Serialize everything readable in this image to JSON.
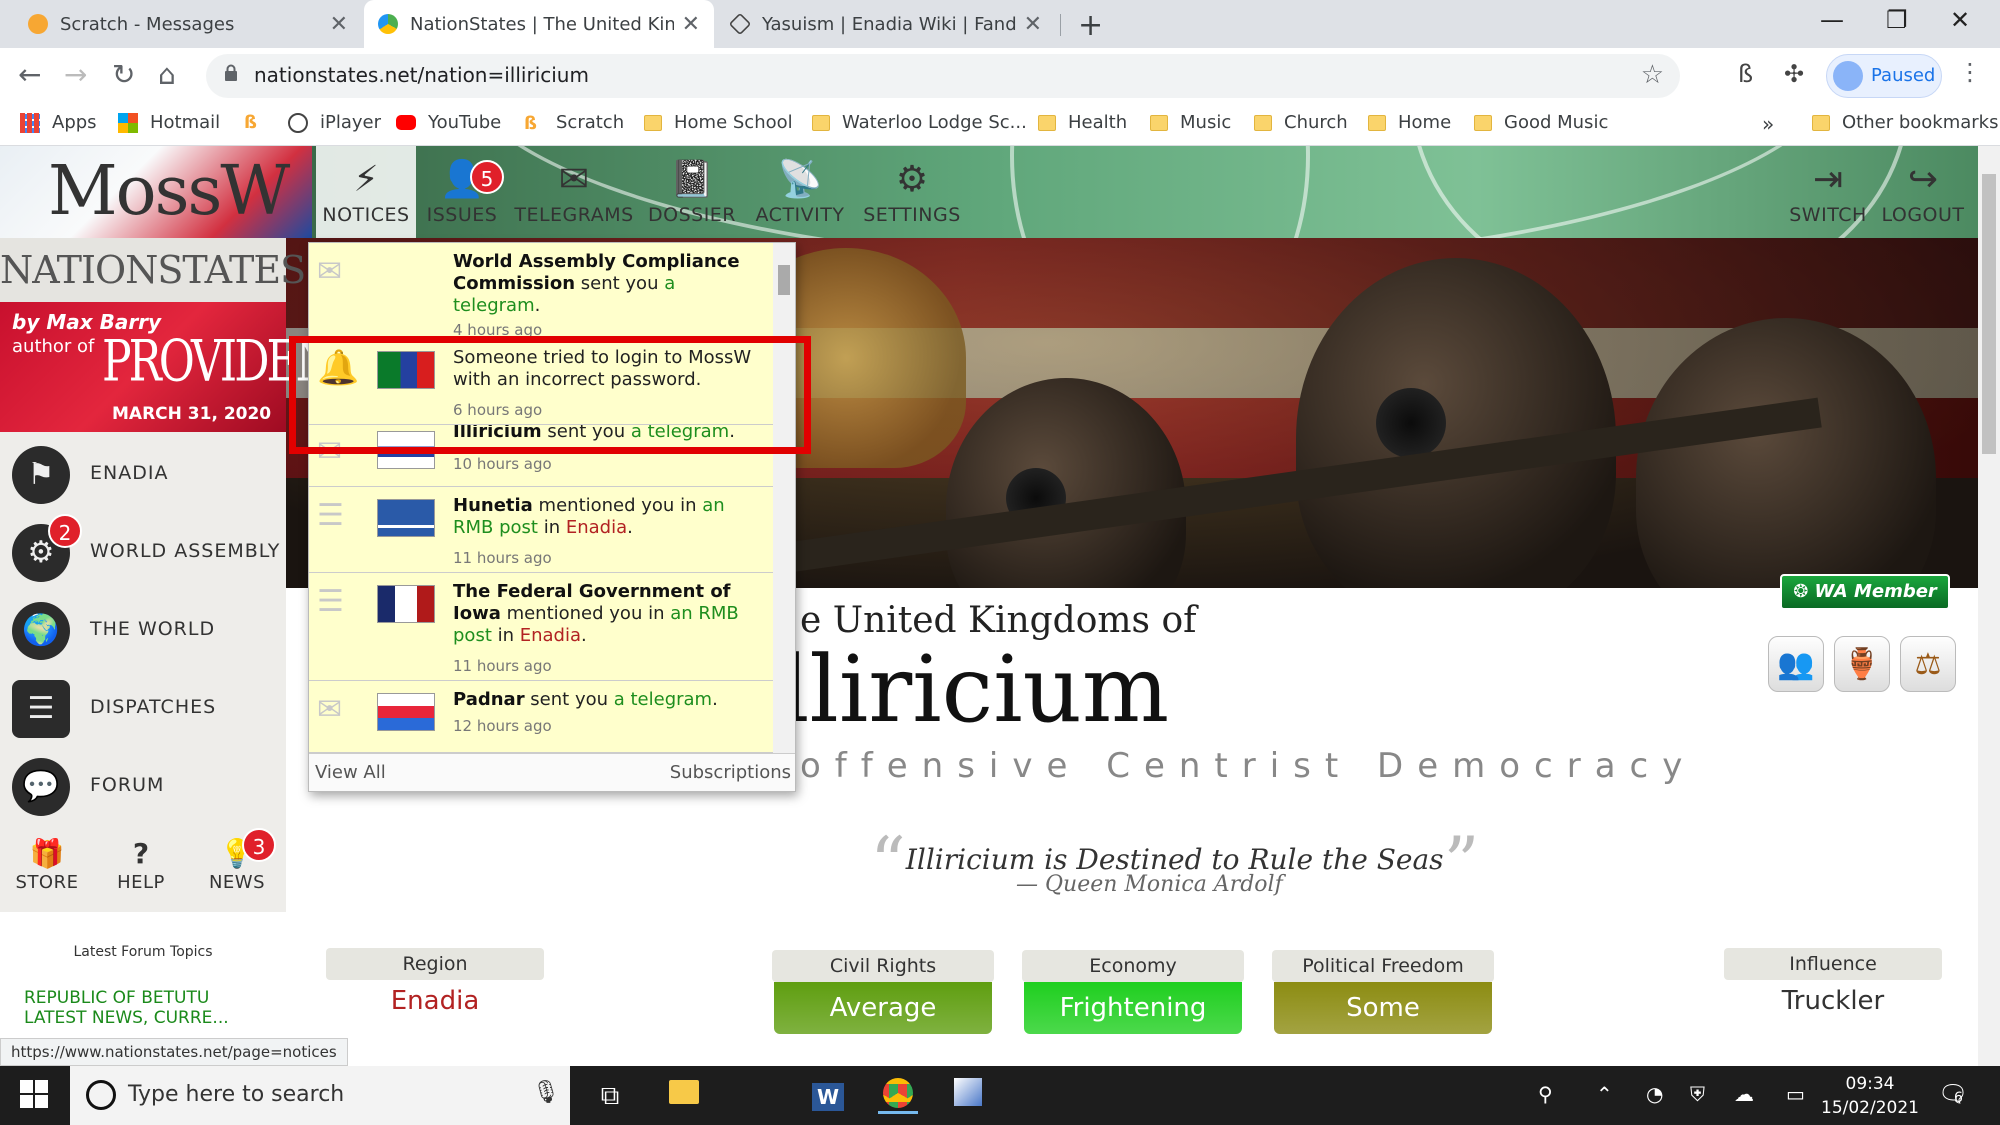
{
  "browser": {
    "tabs": [
      {
        "title": "Scratch - Messages"
      },
      {
        "title": "NationStates | The United Kingdo"
      },
      {
        "title": "Yasuism | Enadia Wiki | Fandom"
      }
    ],
    "url": "nationstates.net/nation=illiricium",
    "profile_label": "Paused",
    "bookmarks": [
      "Apps",
      "Hotmail",
      "iPlayer",
      "YouTube",
      "Scratch",
      "Home School",
      "Waterloo Lodge Sc...",
      "Health",
      "Music",
      "Church",
      "Home",
      "Good Music"
    ],
    "more_label": "»",
    "other_bookmarks": "Other bookmarks",
    "status_url": "https://www.nationstates.net/page=notices"
  },
  "site": {
    "logo": "MossW",
    "brand": "NATIONSTATES",
    "topnav": [
      {
        "label": "NOTICES",
        "icon": "⚡"
      },
      {
        "label": "ISSUES",
        "icon": "👤",
        "badge": "5"
      },
      {
        "label": "TELEGRAMS",
        "icon": "✉"
      },
      {
        "label": "DOSSIER",
        "icon": "📓"
      },
      {
        "label": "ACTIVITY",
        "icon": "📡"
      },
      {
        "label": "SETTINGS",
        "icon": "⚙"
      }
    ],
    "topnav_right": [
      {
        "label": "SWITCH",
        "icon": "⇥"
      },
      {
        "label": "LOGOUT",
        "icon": "↪"
      }
    ],
    "ad": {
      "by": "by Max Barry",
      "author_of": "author of",
      "book": "PROVIDENCE",
      "date": "MARCH 31, 2020"
    },
    "sidenav": [
      {
        "label": "ENADIA",
        "icon": "⚑"
      },
      {
        "label": "WORLD ASSEMBLY",
        "icon": "⚙",
        "badge": "2"
      },
      {
        "label": "THE WORLD",
        "icon": "🌍"
      },
      {
        "label": "DISPATCHES",
        "icon": "☰"
      },
      {
        "label": "FORUM",
        "icon": "💬"
      }
    ],
    "sidebottom": [
      {
        "label": "STORE",
        "icon": "🎁"
      },
      {
        "label": "HELP",
        "icon": "?"
      },
      {
        "label": "NEWS",
        "icon": "💡",
        "badge": "3"
      }
    ],
    "latest_forum_title": "Latest Forum Topics",
    "latest_forum_item_line1": "REPUBLIC OF BETUTU",
    "latest_forum_item_line2": "LATEST NEWS, CURRE..."
  },
  "nation": {
    "pretitle": "e United Kingdoms of",
    "name": "lliricium",
    "type": "offensive Centrist Democracy",
    "motto": "Illiricium is Destined to Rule the Seas",
    "motto_by": "— Queen Monica Ardolf",
    "wa_badge": "WA Member",
    "stats": [
      {
        "head": "Region",
        "value": "Enadia"
      },
      {
        "head": "Civil Rights",
        "value": "Average",
        "color": "#5f9e10"
      },
      {
        "head": "Economy",
        "value": "Frightening",
        "color": "#1fcf1f"
      },
      {
        "head": "Political Freedom",
        "value": "Some",
        "color": "#8c8c12"
      },
      {
        "head": "Influence",
        "value": "Truckler"
      }
    ]
  },
  "notices": {
    "items": [
      {
        "title": "World Assembly Compliance Commission",
        "mid": " sent you ",
        "link": "a telegram",
        "end": ".",
        "time": "4 hours ago",
        "icon": "envelope-icon"
      },
      {
        "text": "Someone tried to login to MossW with an incorrect password.",
        "time": "6 hours ago",
        "icon": "bell-icon"
      },
      {
        "title": "Illiricium",
        "mid": " sent you ",
        "link": "a telegram",
        "end": ".",
        "time": "10 hours ago",
        "icon": "envelope-icon"
      },
      {
        "title": "Hunetia",
        "mid": " mentioned you in ",
        "link": "an RMB post",
        "mid2": " in ",
        "region": "Enadia",
        "end": ".",
        "time": "11 hours ago",
        "icon": "post-icon"
      },
      {
        "title": "The Federal Government of Iowa",
        "mid": " mentioned you in ",
        "link": "an RMB post",
        "mid2": " in ",
        "region": "Enadia",
        "end": ".",
        "time": "11 hours ago",
        "icon": "post-icon"
      },
      {
        "title": "Padnar",
        "mid": " sent you ",
        "link": "a telegram",
        "end": ".",
        "time": "12 hours ago",
        "icon": "envelope-icon"
      }
    ],
    "view_all": "View All",
    "subscriptions": "Subscriptions"
  },
  "taskbar": {
    "search_placeholder": "Type here to search",
    "time": "09:34",
    "date": "15/02/2021",
    "notif_count": "6"
  }
}
